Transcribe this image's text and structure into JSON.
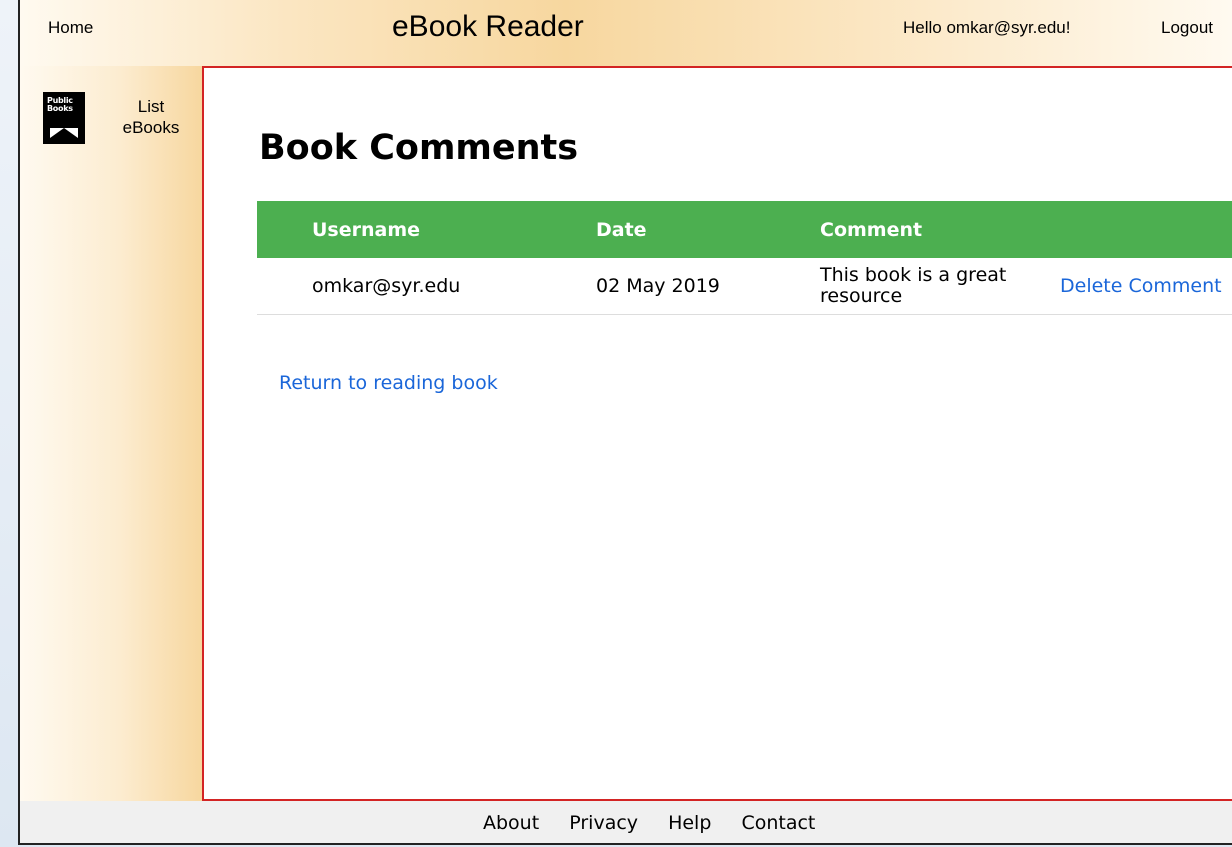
{
  "header": {
    "home_label": "Home",
    "app_title": "eBook Reader",
    "greeting": "Hello omkar@syr.edu!",
    "logout_label": "Logout"
  },
  "sidebar": {
    "logo_text": "Public Books",
    "list_ebooks_label": "List eBooks",
    "logo_icon": "public-books-logo"
  },
  "main": {
    "page_title": "Book Comments",
    "table": {
      "headers": [
        "Username",
        "Date",
        "Comment",
        ""
      ],
      "rows": [
        {
          "username": "omkar@syr.edu",
          "date": "02 May 2019",
          "comment": "This book is a great resource",
          "action": "Delete Comment"
        }
      ]
    },
    "return_link": "Return to reading book"
  },
  "footer": {
    "links": [
      "About",
      "Privacy",
      "Help",
      "Contact"
    ]
  },
  "colors": {
    "table_header_bg": "#4caf50",
    "link_color": "#1a66d9",
    "main_border": "#d32424",
    "gradient_gold": "#f7d79f"
  }
}
